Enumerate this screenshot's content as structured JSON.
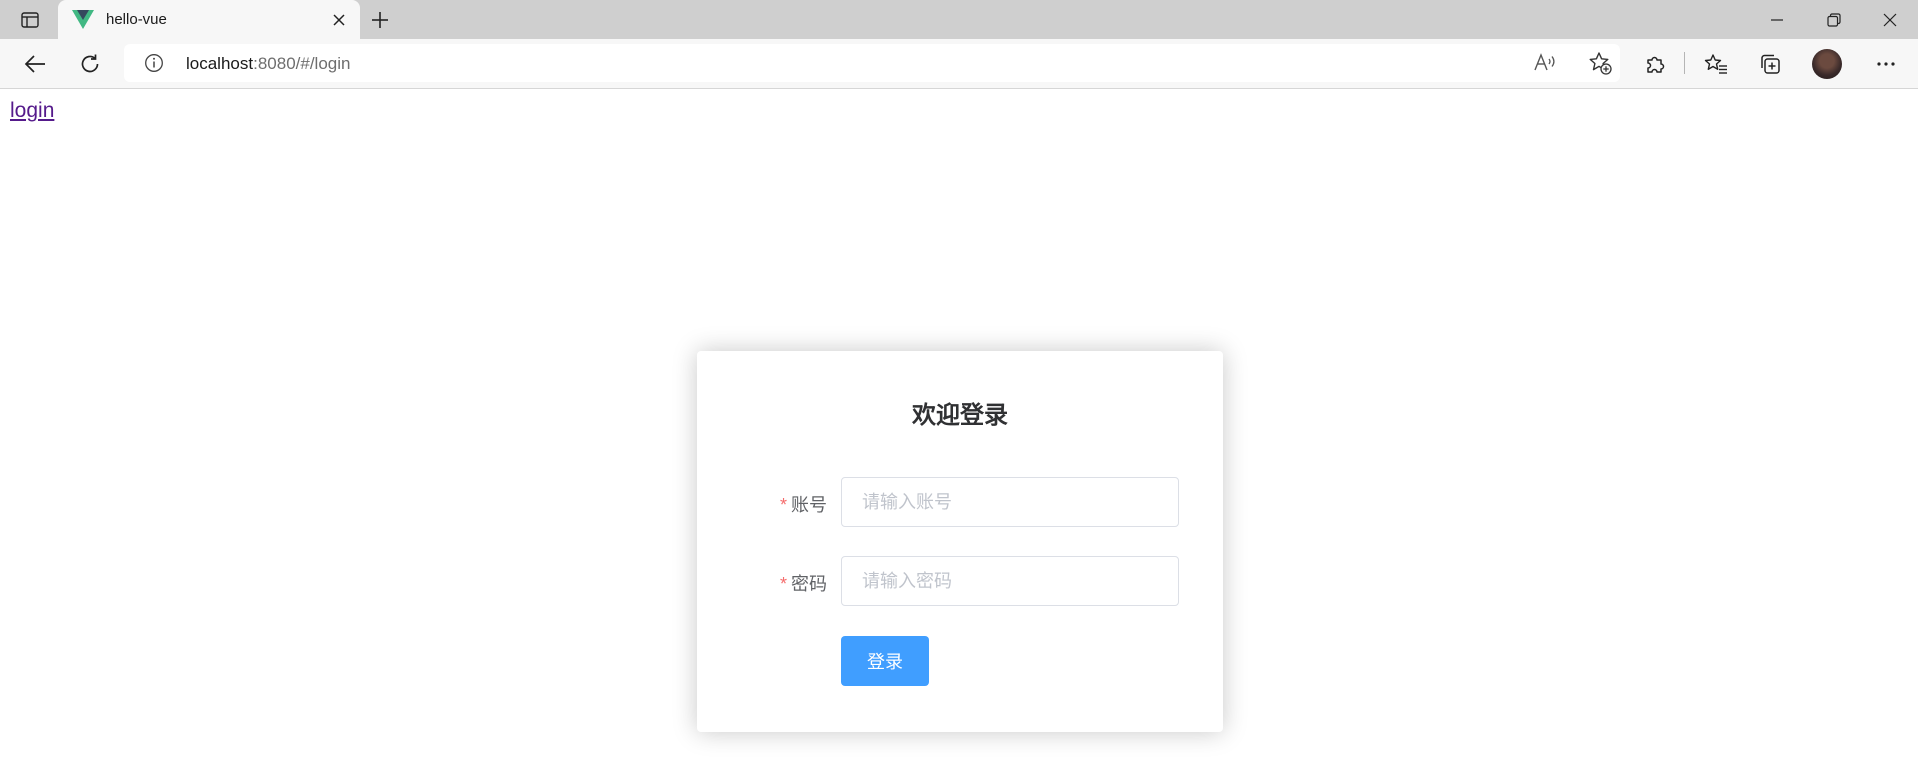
{
  "browser": {
    "tab": {
      "title": "hello-vue",
      "favicon": "vue-logo-icon"
    },
    "address_bar": {
      "host": "localhost",
      "path": ":8080/#/login"
    },
    "toolbar_icons": [
      "back-icon",
      "refresh-icon",
      "site-info-icon",
      "read-aloud-icon",
      "add-favorite-icon",
      "extensions-icon",
      "favorites-icon",
      "collections-icon",
      "profile-avatar",
      "more-icon"
    ],
    "window_controls": [
      "minimize-icon",
      "restore-icon",
      "close-icon"
    ]
  },
  "page": {
    "nav_link": "login",
    "login": {
      "title": "欢迎登录",
      "required_mark": "*",
      "account_label": "账号",
      "account_placeholder": "请输入账号",
      "account_value": "",
      "password_label": "密码",
      "password_placeholder": "请输入密码",
      "password_value": "",
      "submit_label": "登录"
    }
  },
  "colors": {
    "primary": "#409eff",
    "required": "#f56c6c",
    "link": "#551a8b",
    "vue_green": "#41b883",
    "vue_dark": "#35495e"
  }
}
